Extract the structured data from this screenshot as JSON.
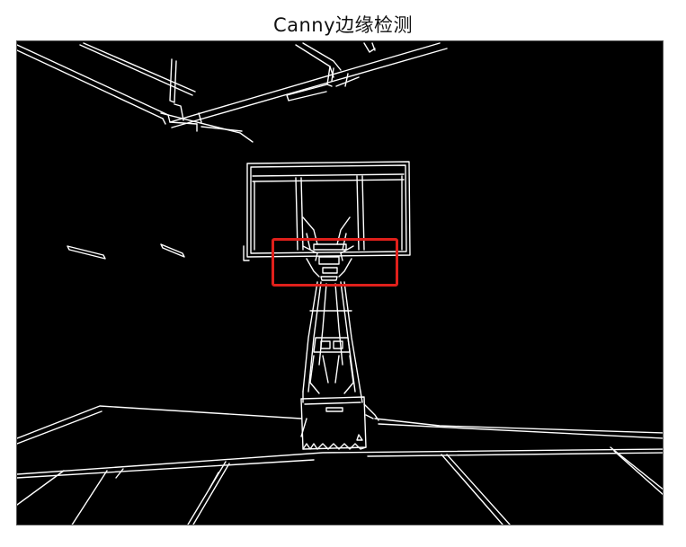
{
  "figure": {
    "title": "Canny边缘检测"
  },
  "image": {
    "background_color": "#000000",
    "edge_color": "#ffffff",
    "highlight_color": "#e0201b"
  }
}
